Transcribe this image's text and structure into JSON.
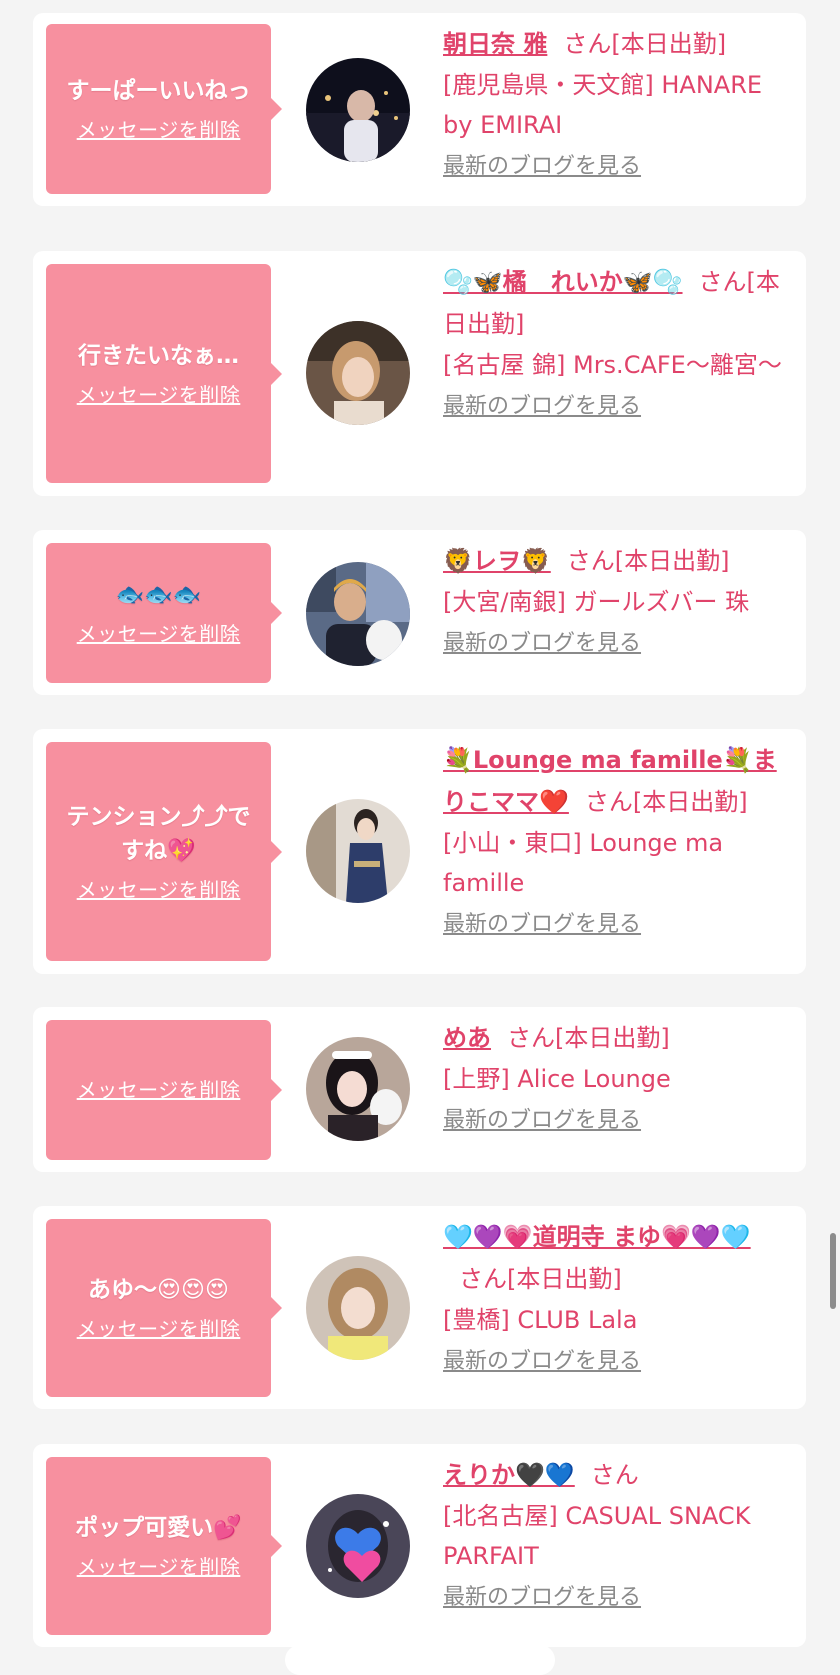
{
  "delete_label": "メッセージを削除",
  "blog_label": "最新のブログを見る",
  "san": "さん",
  "cards": [
    {
      "message": "すーぱーいいねっ",
      "name": "朝日奈 雅",
      "status": "[本日出勤]",
      "shop": "[鹿児島県・天文館] HANARE by EMIRAI"
    },
    {
      "message": "行きたいなぁ…",
      "name": "🫧🦋橘　れいか🦋🫧",
      "status": "[本日出勤]",
      "shop": "[名古屋 錦] Mrs.CAFE～離宮～"
    },
    {
      "message": "🐟🐟🐟",
      "name": "🦁レヲ🦁",
      "status": "[本日出勤]",
      "shop": "[大宮/南銀] ガールズバー 珠"
    },
    {
      "message": "テンション⤴︎⤴︎ですね💖",
      "name": "💐Lounge ma famille💐まりこママ❤️",
      "status": "[本日出勤]",
      "shop": "[小山・東口] Lounge ma famille"
    },
    {
      "message": "",
      "name": "めあ",
      "status": "[本日出勤]",
      "shop": "[上野] Alice Lounge"
    },
    {
      "message": "あゆ〜😍😍😍",
      "name": "🩵💜💗道明寺 まゆ💗💜🩵",
      "status": "[本日出勤]",
      "shop": "[豊橋] CLUB Lala"
    },
    {
      "message": "ポップ可愛い💕",
      "name": "えりか🖤💙",
      "status": "",
      "shop": "[北名古屋] CASUAL SNACK PARFAIT"
    }
  ]
}
